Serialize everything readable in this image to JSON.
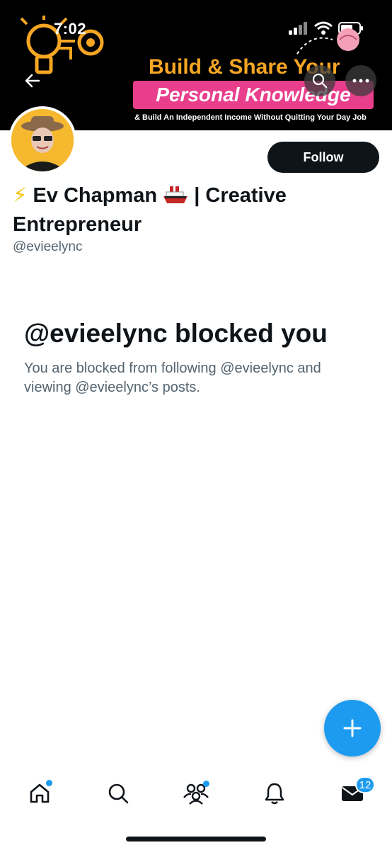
{
  "status_bar": {
    "time": "7:02"
  },
  "banner": {
    "headline": "Build & Share Your",
    "highlight": "Personal Knowledge",
    "subline": "& Build An Independent Income Without Quitting Your Day Job",
    "colors": {
      "background": "#000000",
      "headline": "#f5a623",
      "highlight_bg": "#e83e8c"
    }
  },
  "icons": {
    "back": "arrow-left-icon",
    "search": "search-icon",
    "more": "more-horizontal-icon",
    "lightning": "lightning-emoji",
    "ship": "ship-emoji"
  },
  "profile": {
    "name_part1": "Ev Chapman",
    "name_part2": "| Creative Entrepreneur",
    "handle": "@evieelync",
    "follow_label": "Follow"
  },
  "blocked": {
    "title": "@evieelync blocked you",
    "description": "You are blocked from following @evieelync and viewing @evieelync’s posts."
  },
  "nav": {
    "messages_badge": "12",
    "items": [
      "home-icon",
      "search-icon",
      "communities-icon",
      "notifications-icon",
      "messages-icon"
    ]
  },
  "colors": {
    "accent": "#1d9bf0",
    "text": "#0f1419",
    "muted": "#536471"
  }
}
